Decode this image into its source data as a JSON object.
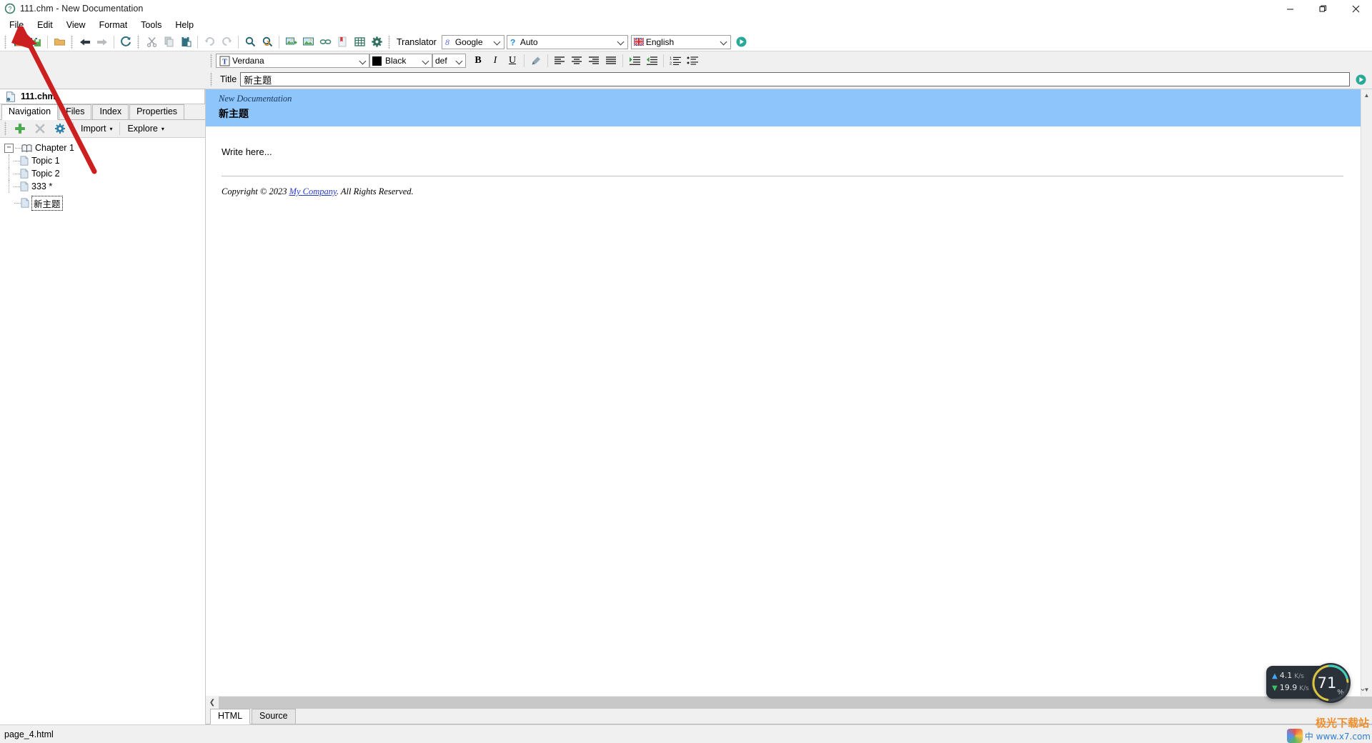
{
  "window": {
    "title": "111.chm - New Documentation",
    "app_icon": "help-chm-icon",
    "minimize": "—",
    "maximize": "❐",
    "close": "✕"
  },
  "menubar": {
    "items": [
      {
        "label": "File",
        "name": "menu-file"
      },
      {
        "label": "Edit",
        "name": "menu-edit"
      },
      {
        "label": "View",
        "name": "menu-view"
      },
      {
        "label": "Format",
        "name": "menu-format"
      },
      {
        "label": "Tools",
        "name": "menu-tools"
      },
      {
        "label": "Help",
        "name": "menu-help"
      }
    ]
  },
  "main_toolbar": {
    "buttons": [
      {
        "name": "save-icon"
      },
      {
        "name": "save-all-icon"
      },
      {
        "name": "open-folder-icon"
      },
      {
        "name": "back-arrow-icon"
      },
      {
        "name": "forward-arrow-icon"
      },
      {
        "name": "refresh-icon"
      },
      {
        "name": "cut-icon"
      },
      {
        "name": "copy-icon"
      },
      {
        "name": "paste-icon"
      },
      {
        "name": "undo-icon"
      },
      {
        "name": "redo-icon"
      },
      {
        "name": "find-icon"
      },
      {
        "name": "find-replace-icon"
      },
      {
        "name": "insert-image-icon"
      },
      {
        "name": "image-properties-icon"
      },
      {
        "name": "insert-link-icon"
      },
      {
        "name": "bookmark-icon"
      },
      {
        "name": "insert-table-icon"
      },
      {
        "name": "settings-gear-icon"
      }
    ],
    "translator_label": "Translator",
    "engine": {
      "value": "Google",
      "icon": "google-g-icon"
    },
    "source_lang": {
      "value": "Auto",
      "icon": "question-mark-icon"
    },
    "target_lang": {
      "value": "English",
      "icon": "uk-flag-icon"
    },
    "run_button": "translate-run-icon"
  },
  "format_toolbar": {
    "font": {
      "value": "Verdana",
      "icon": "font-picker-icon"
    },
    "color": {
      "value": "Black",
      "swatch": "#000000"
    },
    "size": {
      "value": "def"
    },
    "bold": "B",
    "italic": "I",
    "underline": "U",
    "highlight": "highlighter-icon",
    "align_left": "align-left-icon",
    "align_center": "align-center-icon",
    "align_right": "align-right-icon",
    "align_justify": "align-justify-icon",
    "indent_increase": "indent-increase-icon",
    "indent_decrease": "indent-decrease-icon",
    "ordered_list": "ordered-list-icon",
    "unordered_list": "unordered-list-icon"
  },
  "title_row": {
    "label": "Title",
    "value": "新主题",
    "go_button": "title-apply-icon"
  },
  "left_panel": {
    "document_name": "111.chm",
    "document_icon": "chm-file-icon",
    "tabs": [
      {
        "label": "Navigation",
        "active": true
      },
      {
        "label": "Files",
        "active": false
      },
      {
        "label": "Index",
        "active": false
      },
      {
        "label": "Properties",
        "active": false
      }
    ],
    "tree_toolbar": {
      "add": "add-plus-icon",
      "delete": "delete-x-icon",
      "settings": "tree-settings-icon",
      "import": "Import",
      "explore": "Explore"
    },
    "tree": [
      {
        "label": "Chapter 1",
        "icon": "book-icon",
        "level": 0,
        "expanded": true,
        "selected": false
      },
      {
        "label": "Topic 1",
        "icon": "page-icon",
        "level": 1,
        "selected": false
      },
      {
        "label": "Topic 2",
        "icon": "page-icon",
        "level": 1,
        "selected": false
      },
      {
        "label": "333 *",
        "icon": "page-icon",
        "level": 1,
        "selected": false
      },
      {
        "label": "新主题",
        "icon": "page-icon",
        "level": 0,
        "selected": true
      }
    ]
  },
  "editor": {
    "banner_subtitle": "New Documentation",
    "banner_title": "新主题",
    "banner_color": "#8ec5fb",
    "body_text": "Write here...",
    "footer_prefix": "Copyright © 2023 ",
    "footer_link": "My Company",
    "footer_suffix": ". All Rights Reserved."
  },
  "bottom_tabs": [
    {
      "label": "HTML",
      "active": true
    },
    {
      "label": "Source",
      "active": false
    }
  ],
  "statusbar": {
    "text": "page_4.html"
  },
  "overlays": {
    "network": {
      "upload": "4.1",
      "upload_unit": "K/s",
      "download": "19.9",
      "download_unit": "K/s"
    },
    "cpu": {
      "value": "71",
      "unit": "%"
    },
    "watermark": "极光下载站",
    "ime": "中 www.x7.com"
  }
}
